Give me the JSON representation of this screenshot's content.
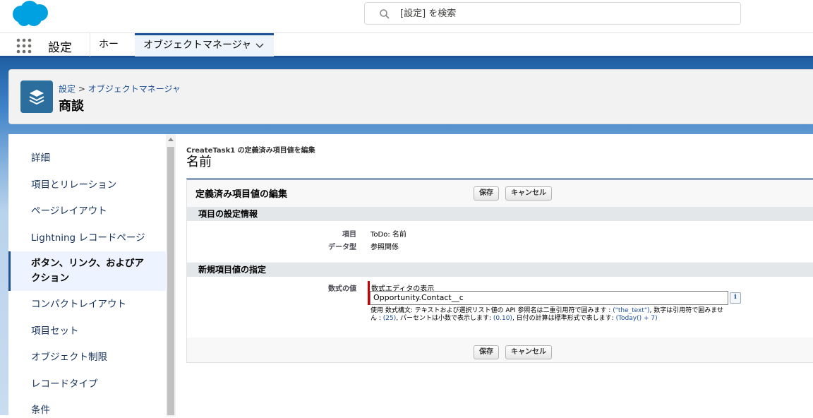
{
  "header": {
    "search_placeholder": "[設定] を検索",
    "icons": {
      "logo": "salesforce-cloud-logo",
      "search": "search-icon"
    }
  },
  "nav": {
    "app_name": "設定",
    "tabs": [
      {
        "label": "ホーム"
      },
      {
        "label": "オブジェクトマネージャ"
      }
    ]
  },
  "page_header": {
    "breadcrumb_root": "設定",
    "breadcrumb_sep": ">",
    "breadcrumb_current": "オブジェクトマネージャ",
    "title": "商談"
  },
  "sidebar": {
    "items": [
      {
        "label": "詳細"
      },
      {
        "label": "項目とリレーション"
      },
      {
        "label": "ページレイアウト"
      },
      {
        "label": "Lightning レコードページ"
      },
      {
        "label": "ボタン、リンク、およびアクション"
      },
      {
        "label": "コンパクトレイアウト"
      },
      {
        "label": "項目セット"
      },
      {
        "label": "オブジェクト制限"
      },
      {
        "label": "レコードタイプ"
      },
      {
        "label": "条件"
      }
    ],
    "active_index": 4
  },
  "main": {
    "subtitle": "CreateTask1 の定義済み項目値を編集",
    "title": "名前",
    "block_title": "定義済み項目値の編集",
    "save_label": "保存",
    "cancel_label": "キャンセル",
    "section1": {
      "header": "項目の設定情報",
      "rows": [
        {
          "label": "項目",
          "value": "ToDo: 名前"
        },
        {
          "label": "データ型",
          "value": "参照関係"
        }
      ]
    },
    "section2": {
      "header": "新規項目値の指定",
      "formula_label": "数式の値",
      "formula_editor_link": "数式エディタの表示",
      "formula_value": "Opportunity.Contact__c",
      "info_label": "i",
      "hint": {
        "p1": "使用 数式構文: テキストおよび選択リスト値の API 参照名は二重引用符で囲みます : ",
        "c1": "(\"the_text\")",
        "p2": ", 数字は引用符で囲みません : ",
        "c2": "(25)",
        "p3": ", パーセントは小数で表示します: ",
        "c3": "(0.10)",
        "p4": ", 日付の計算は標準形式で表します: ",
        "c4": "(Today() + 7)"
      }
    }
  }
}
